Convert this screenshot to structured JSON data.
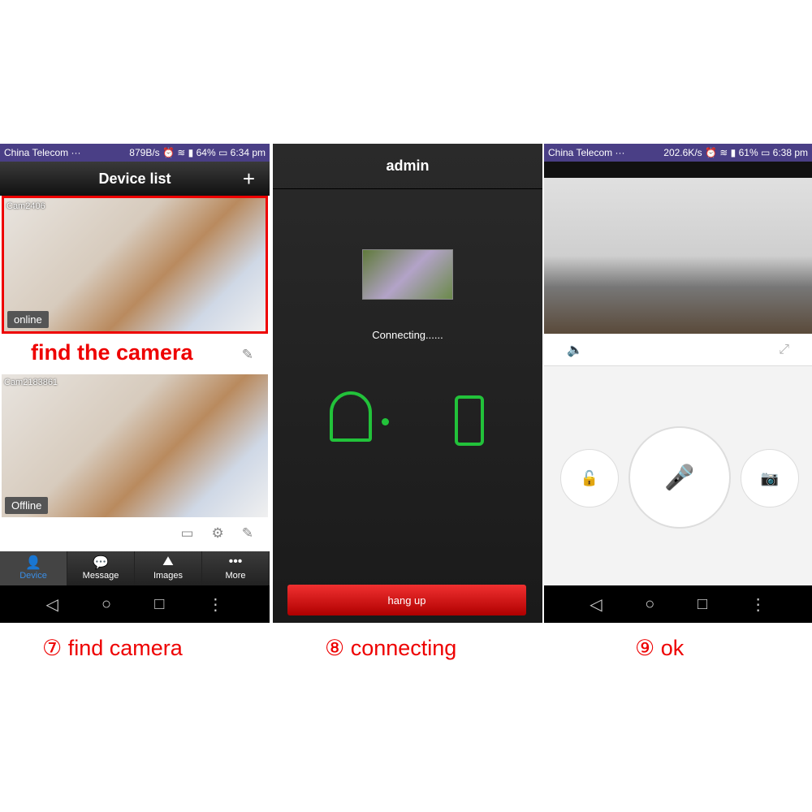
{
  "panel1": {
    "status": {
      "carrier": "China Telecom ···",
      "speed": "879B/s",
      "battery": "64%",
      "time": "6:34 pm"
    },
    "title": "Device list",
    "add": "+",
    "devices": [
      {
        "name": "Cam2406",
        "status": "online"
      },
      {
        "name": "Cam2183861",
        "status": "Offline"
      }
    ],
    "annotation": "find the camera",
    "tabs": [
      {
        "label": "Device",
        "icon": "person-icon"
      },
      {
        "label": "Message",
        "icon": "chat-icon"
      },
      {
        "label": "Images",
        "icon": "image-icon"
      },
      {
        "label": "More",
        "icon": "more-icon"
      }
    ]
  },
  "panel2": {
    "title": "admin",
    "status": "Connecting......",
    "hangup": "hang up"
  },
  "panel3": {
    "status": {
      "carrier": "China Telecom ···",
      "speed": "202.6K/s",
      "battery": "61%",
      "time": "6:38 pm"
    }
  },
  "captions": [
    "⑦ find camera",
    "⑧ connecting",
    "⑨ ok"
  ],
  "colors": {
    "accent": "#e00000",
    "green": "#22c23a",
    "blue": "#3ab0e0"
  }
}
